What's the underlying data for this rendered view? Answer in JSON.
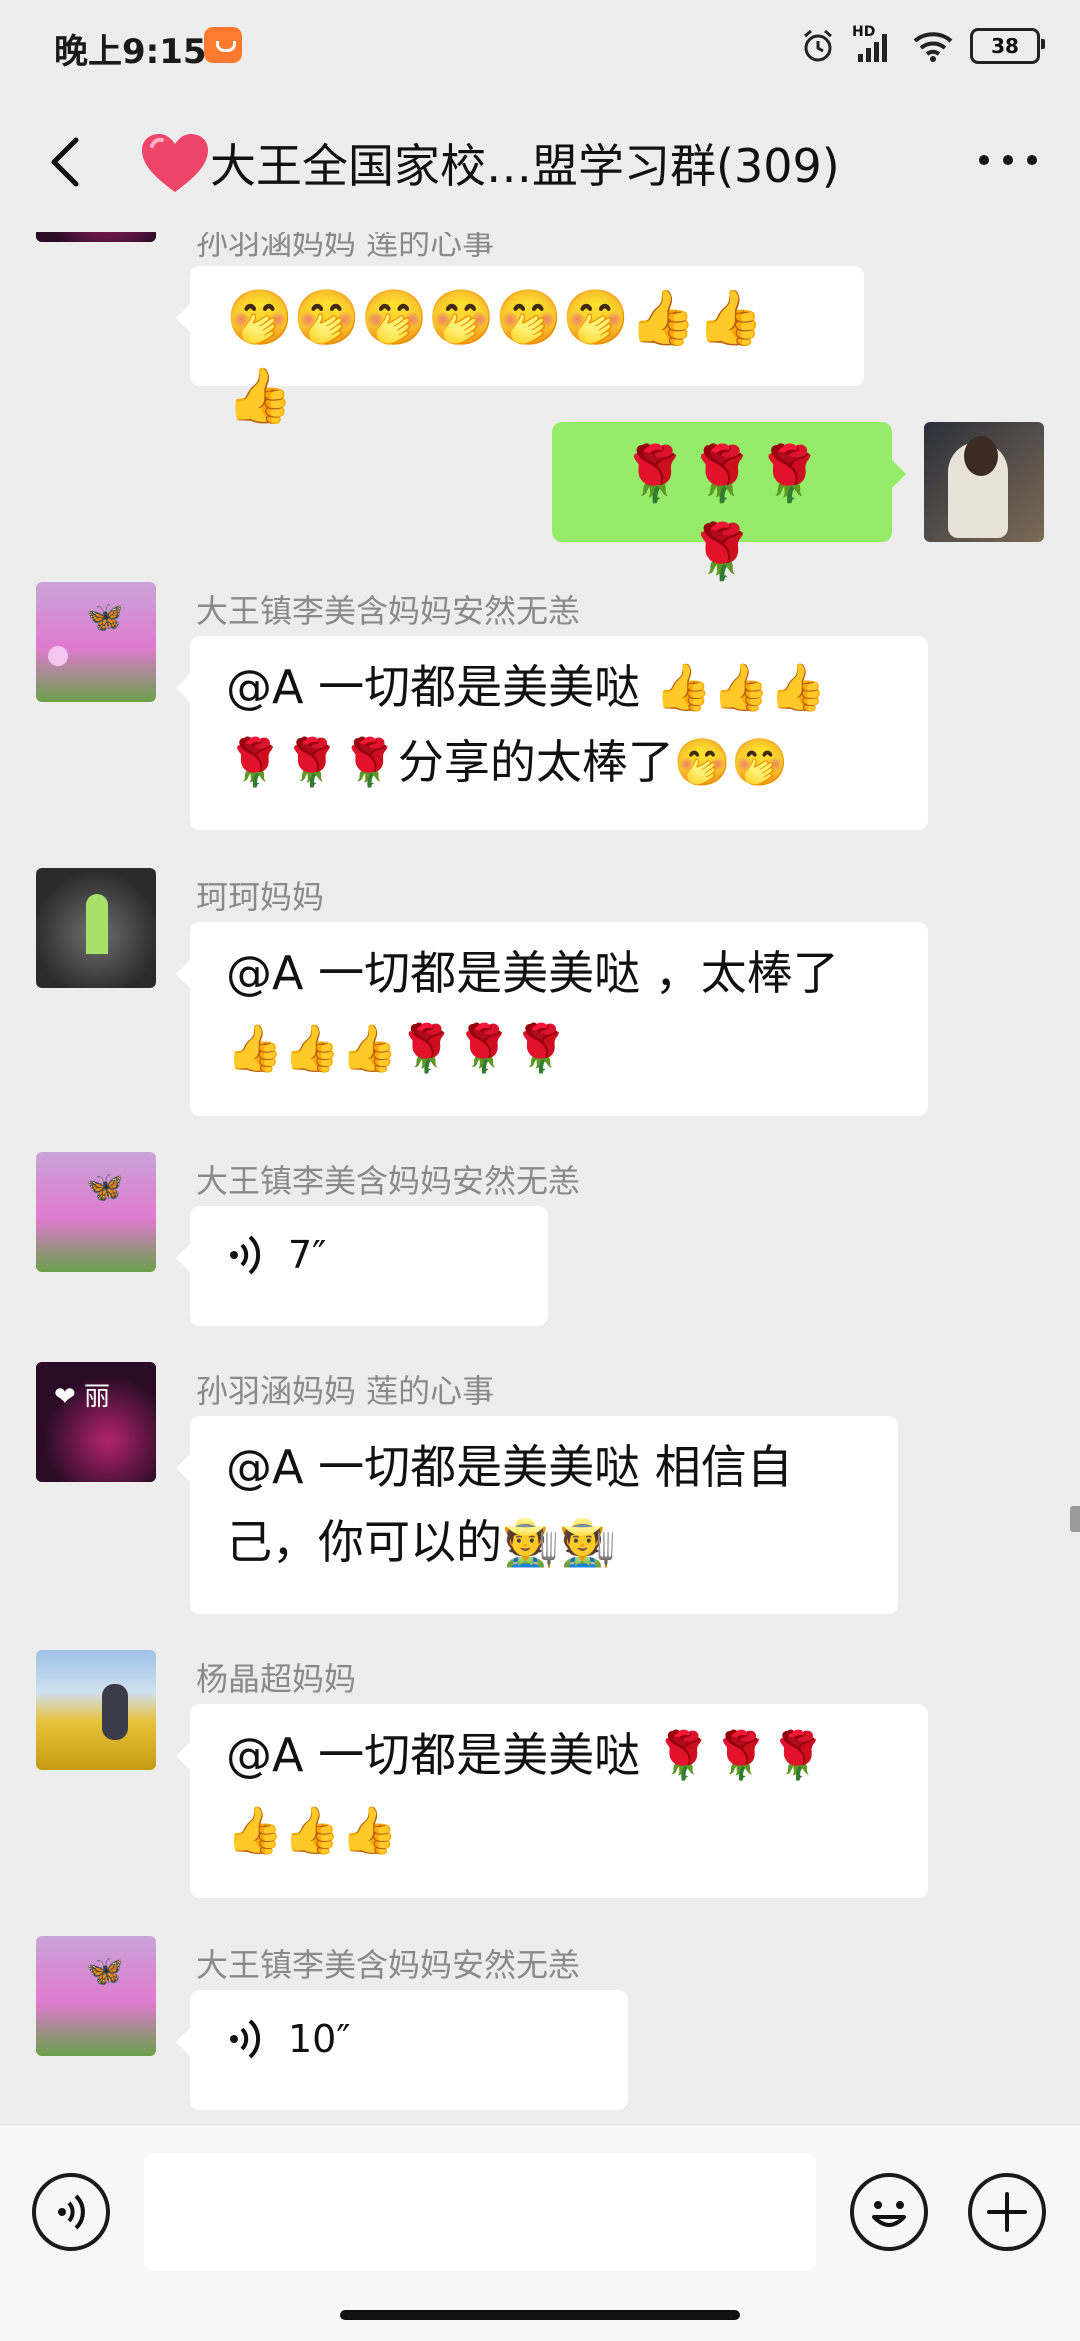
{
  "status_bar": {
    "time": "晚上9:15",
    "network_label": "HD",
    "battery": "38"
  },
  "header": {
    "title": "大王全国家校…盟学习群(309)",
    "back_icon": "chevron-left-icon",
    "more_icon": "more-dots-icon",
    "title_icon": "red-heart-icon"
  },
  "messages": [
    {
      "sender": "孙羽涵妈妈  莲的心事",
      "direction": "in",
      "avatar": "avatar-li-neon",
      "content": "🤭🤭🤭🤭🤭🤭👍👍👍"
    },
    {
      "sender": "",
      "direction": "out",
      "avatar": "avatar-self-girl",
      "content": "🌹🌹🌹🌹"
    },
    {
      "sender": "大王镇李美含妈妈安然无恙",
      "direction": "in",
      "avatar": "avatar-butterfly-flowers",
      "content_lines": [
        "@A 一切都是美美哒 👍👍👍",
        "🌹🌹🌹分享的太棒了🤭🤭"
      ]
    },
    {
      "sender": "珂珂妈妈",
      "direction": "in",
      "avatar": "avatar-sprout",
      "content_lines": [
        "@A 一切都是美美哒 ，太棒了",
        "👍👍👍🌹🌹🌹"
      ]
    },
    {
      "sender": "大王镇李美含妈妈安然无恙",
      "direction": "in",
      "avatar": "avatar-butterfly-flowers",
      "type": "voice",
      "duration": "7″"
    },
    {
      "sender": "孙羽涵妈妈  莲的心事",
      "direction": "in",
      "avatar": "avatar-li-neon",
      "content_lines": [
        "@A 一切都是美美哒  相信自",
        "己，你可以的🧑‍🌾🧑‍🌾"
      ]
    },
    {
      "sender": "杨晶超妈妈",
      "direction": "in",
      "avatar": "avatar-sunflower-field",
      "content_lines": [
        "@A 一切都是美美哒 🌹🌹🌹",
        "👍👍👍"
      ]
    },
    {
      "sender": "大王镇李美含妈妈安然无恙",
      "direction": "in",
      "avatar": "avatar-butterfly-flowers",
      "type": "voice",
      "duration": "10″"
    }
  ],
  "avatar_li_text": "❤ 丽",
  "bottom_bar": {
    "input_value": "",
    "voice_icon": "voice-input-icon",
    "emoji_icon": "smiley-icon",
    "plus_icon": "plus-icon"
  },
  "colors": {
    "background": "#ededed",
    "outgoing_bubble": "#95ec69",
    "incoming_bubble": "#ffffff",
    "sender_name": "#8a8a8a"
  }
}
